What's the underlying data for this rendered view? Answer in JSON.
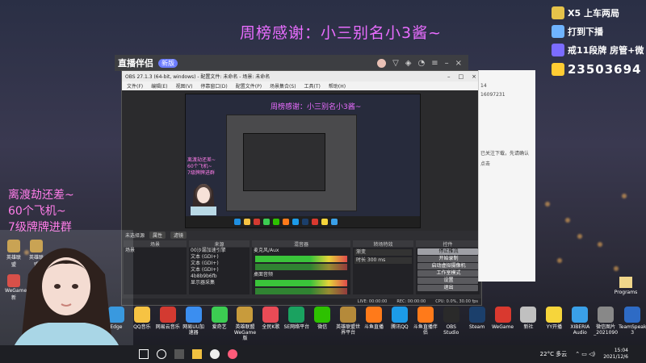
{
  "overlay": {
    "banner": "周榜感谢：小三别名小3酱~",
    "left_text": [
      "离渡劫还差~",
      "60个飞机~",
      "7级牌牌进群"
    ],
    "ranking": [
      {
        "text": "X5  上车两局",
        "color": "#e6c34a"
      },
      {
        "text": "打到下播",
        "color": "#6fb3ff"
      },
      {
        "text": "戒11段牌  房管+微",
        "color": "#7b6cff"
      },
      {
        "text": "23503694",
        "color": "#ffcc33"
      }
    ]
  },
  "app_window": {
    "logo": "直播伴侣",
    "tag": "新版"
  },
  "obs": {
    "title": "OBS 27.1.3 (64-bit, windows) - 配置文件: 未命名 - 场景: 未命名",
    "menu": [
      "文件(F)",
      "编辑(E)",
      "视图(V)",
      "停靠窗口(D)",
      "配置文件(P)",
      "场景集合(S)",
      "工具(T)",
      "帮助(H)"
    ],
    "preview_banner": "周榜感谢：小三别名小3酱~",
    "preview_left": [
      "离渡劫还差~",
      "60个飞机~",
      "7级牌牌进群"
    ],
    "source_label": "未选择源",
    "prop_btn": "属性",
    "filter_btn": "滤镜",
    "docks": {
      "scenes": "场景",
      "sources": "来源",
      "mixer": "混音器",
      "transitions": "转场特效",
      "controls": "控件"
    },
    "scene_items": [
      "场景"
    ],
    "source_items": [
      "00沙漏加速引擎",
      "文本 (GDI+)",
      "文本 (GDI+)",
      "文本 (GDI+)",
      "4b8b9b6fb",
      "显示器采集"
    ],
    "mixer_items": [
      "麦克风/Aux",
      "桌面音频"
    ],
    "transition_items": [
      "渐变",
      "时长  300 ms"
    ],
    "controls": [
      "停止推流",
      "开始录制",
      "启动虚拟摄像机",
      "工作室模式",
      "设置",
      "退出"
    ],
    "status": [
      "LIVE: 00:00:00",
      "REC: 00:00:00",
      "CPU: 0.0%, 30.00 fps"
    ]
  },
  "chat": {
    "number": "16097231",
    "lines": [
      "14",
      "已关注下载，先请确认",
      "点击"
    ]
  },
  "desktop_icons": [
    {
      "label": "英雄联盟",
      "color": "#c89b3c"
    },
    {
      "label": "英雄联盟",
      "color": "#c89b3c"
    },
    {
      "label": "WeGame新",
      "color": "#d9392f"
    }
  ],
  "taskbar_apps": [
    {
      "label": "Edge",
      "color": "#1f8fe0"
    },
    {
      "label": "QQ音乐",
      "color": "#f6c343"
    },
    {
      "label": "网易云音乐",
      "color": "#d33a31"
    },
    {
      "label": "网易UU加速器",
      "color": "#3b8ef0"
    },
    {
      "label": "爱奇艺",
      "color": "#3ccd52"
    },
    {
      "label": "英雄联盟WeGame版",
      "color": "#c89b3c"
    },
    {
      "label": "全民K歌",
      "color": "#e94b56"
    },
    {
      "label": "SE网络平台",
      "color": "#1aa260"
    },
    {
      "label": "微信",
      "color": "#2dc100"
    },
    {
      "label": "英雄联盟世界平台",
      "color": "#b58a3a"
    },
    {
      "label": "斗鱼直播",
      "color": "#ff7a1a"
    },
    {
      "label": "腾讯QQ",
      "color": "#1c9be8"
    },
    {
      "label": "斗鱼直播伴侣",
      "color": "#ff7a1a"
    },
    {
      "label": "OBS Studio",
      "color": "#2a2a2a"
    },
    {
      "label": "Steam",
      "color": "#1b3f6b"
    },
    {
      "label": "WeGame",
      "color": "#d9392f"
    },
    {
      "label": "新社",
      "color": "#c0c0c0"
    },
    {
      "label": "YY开播",
      "color": "#f6d53b"
    },
    {
      "label": "XIBERIA Audio",
      "color": "#3aa0e8"
    },
    {
      "label": "微信图片_2021090",
      "color": "#888888"
    },
    {
      "label": "TeamSpeak 3",
      "color": "#2e6bc5"
    }
  ],
  "programs_label": "Programs",
  "tray": {
    "weather": "22°C 多云",
    "time": "15:04",
    "date": "2021/12/6"
  }
}
